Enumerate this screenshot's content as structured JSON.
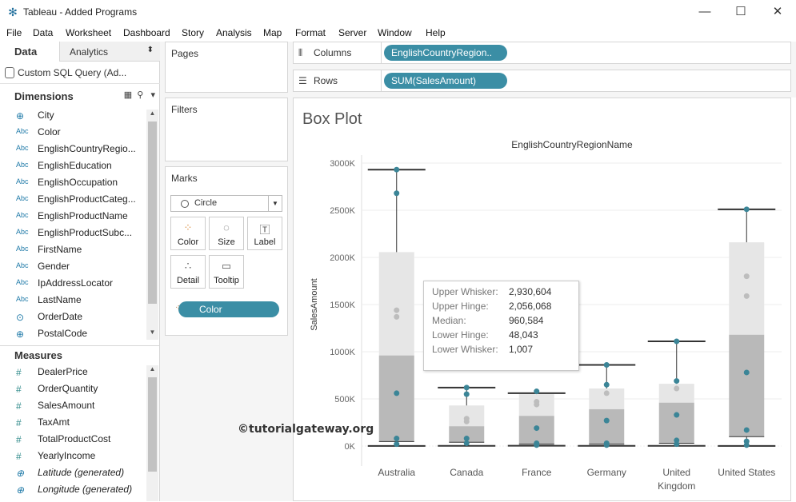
{
  "window": {
    "title": "Tableau - Added Programs",
    "icon": "tableau-icon",
    "minimize": "—",
    "maximize": "☐",
    "close": "✕"
  },
  "menu": [
    "File",
    "Data",
    "Worksheet",
    "Dashboard",
    "Story",
    "Analysis",
    "Map",
    "Format",
    "Server",
    "Window",
    "Help"
  ],
  "left_pane": {
    "tab_data": "Data",
    "tab_analytics": "Analytics",
    "datasource": "Custom SQL Query (Ad...",
    "dimensions_label": "Dimensions",
    "dimensions": [
      {
        "icon": "globe-icon",
        "glyph": "⊕",
        "name": "City"
      },
      {
        "icon": "abc-icon",
        "glyph": "Abc",
        "name": "Color"
      },
      {
        "icon": "abc-icon",
        "glyph": "Abc",
        "name": "EnglishCountryRegio..."
      },
      {
        "icon": "abc-icon",
        "glyph": "Abc",
        "name": "EnglishEducation"
      },
      {
        "icon": "abc-icon",
        "glyph": "Abc",
        "name": "EnglishOccupation"
      },
      {
        "icon": "abc-icon",
        "glyph": "Abc",
        "name": "EnglishProductCateg..."
      },
      {
        "icon": "abc-icon",
        "glyph": "Abc",
        "name": "EnglishProductName"
      },
      {
        "icon": "abc-icon",
        "glyph": "Abc",
        "name": "EnglishProductSubc..."
      },
      {
        "icon": "abc-icon",
        "glyph": "Abc",
        "name": "FirstName"
      },
      {
        "icon": "abc-icon",
        "glyph": "Abc",
        "name": "Gender"
      },
      {
        "icon": "abc-icon",
        "glyph": "Abc",
        "name": "IpAddressLocator"
      },
      {
        "icon": "abc-icon",
        "glyph": "Abc",
        "name": "LastName"
      },
      {
        "icon": "date-icon",
        "glyph": "⊙",
        "name": "OrderDate"
      },
      {
        "icon": "globe-icon",
        "glyph": "⊕",
        "name": "PostalCode"
      }
    ],
    "measures_label": "Measures",
    "measures": [
      {
        "icon": "number-icon",
        "glyph": "#",
        "name": "DealerPrice",
        "italic": false
      },
      {
        "icon": "number-icon",
        "glyph": "#",
        "name": "OrderQuantity",
        "italic": false
      },
      {
        "icon": "number-icon",
        "glyph": "#",
        "name": "SalesAmount",
        "italic": false
      },
      {
        "icon": "number-icon",
        "glyph": "#",
        "name": "TaxAmt",
        "italic": false
      },
      {
        "icon": "number-icon",
        "glyph": "#",
        "name": "TotalProductCost",
        "italic": false
      },
      {
        "icon": "number-icon",
        "glyph": "#",
        "name": "YearlyIncome",
        "italic": false
      },
      {
        "icon": "globe-icon",
        "glyph": "⊕",
        "name": "Latitude (generated)",
        "italic": true
      },
      {
        "icon": "globe-icon",
        "glyph": "⊕",
        "name": "Longitude (generated)",
        "italic": true
      }
    ]
  },
  "cards": {
    "pages": "Pages",
    "filters": "Filters",
    "marks": "Marks",
    "mark_type": "Circle",
    "buttons": {
      "color": "Color",
      "size": "Size",
      "label": "Label",
      "detail": "Detail",
      "tooltip": "Tooltip"
    },
    "color_pill": "Color"
  },
  "shelves": {
    "columns_label": "Columns",
    "columns_pill": "EnglishCountryRegion..",
    "rows_label": "Rows",
    "rows_pill": "SUM(SalesAmount)"
  },
  "viz": {
    "sheet_title": "Box Plot",
    "watermark": "©tutorialgateway.org"
  },
  "tooltip": {
    "rows": [
      {
        "key": "Upper Whisker:",
        "value": "2,930,604"
      },
      {
        "key": "Upper Hinge:",
        "value": "2,056,068"
      },
      {
        "key": "Median:",
        "value": "960,584"
      },
      {
        "key": "Lower Hinge:",
        "value": "48,043"
      },
      {
        "key": "Lower Whisker:",
        "value": "1,007"
      }
    ]
  },
  "chart_data": {
    "type": "scatter",
    "title": "",
    "xlabel": "EnglishCountryRegionName",
    "ylabel": "SalesAmount",
    "ylim": [
      0,
      3000000
    ],
    "yticks": [
      0,
      500000,
      1000000,
      1500000,
      2000000,
      2500000,
      3000000
    ],
    "ytick_labels": [
      "0K",
      "500K",
      "1000K",
      "1500K",
      "2000K",
      "2500K",
      "3000K"
    ],
    "categories": [
      "Australia",
      "Canada",
      "France",
      "Germany",
      "United Kingdom",
      "United States"
    ],
    "category_labels": [
      [
        "Australia"
      ],
      [
        "Canada"
      ],
      [
        "France"
      ],
      [
        "Germany"
      ],
      [
        "United",
        "Kingdom"
      ],
      [
        "United States"
      ]
    ],
    "boxes": [
      {
        "category": "Australia",
        "lower_whisker": 1007,
        "lower_hinge": 48043,
        "median": 960584,
        "upper_hinge": 2056068,
        "upper_whisker": 2930604
      },
      {
        "category": "Canada",
        "lower_whisker": 2000,
        "lower_hinge": 40000,
        "median": 210000,
        "upper_hinge": 430000,
        "upper_whisker": 620000
      },
      {
        "category": "France",
        "lower_whisker": 3000,
        "lower_hinge": 20000,
        "median": 320000,
        "upper_hinge": 550000,
        "upper_whisker": 560000
      },
      {
        "category": "Germany",
        "lower_whisker": 2000,
        "lower_hinge": 20000,
        "median": 390000,
        "upper_hinge": 610000,
        "upper_whisker": 860000
      },
      {
        "category": "United Kingdom",
        "lower_whisker": 2000,
        "lower_hinge": 30000,
        "median": 460000,
        "upper_hinge": 660000,
        "upper_whisker": 1110000
      },
      {
        "category": "United States",
        "lower_whisker": 1000,
        "lower_hinge": 100000,
        "median": 1180000,
        "upper_hinge": 2160000,
        "upper_whisker": 2510000
      }
    ],
    "points": [
      {
        "category": "Australia",
        "values": [
          2930604,
          2680000,
          1440000,
          1370000,
          560000,
          80000,
          20000
        ],
        "highlight": [
          true,
          true,
          false,
          false,
          true,
          true,
          true
        ]
      },
      {
        "category": "Canada",
        "values": [
          620000,
          550000,
          290000,
          260000,
          80000,
          30000
        ],
        "highlight": [
          true,
          true,
          false,
          false,
          true,
          true
        ]
      },
      {
        "category": "France",
        "values": [
          580000,
          470000,
          440000,
          190000,
          30000,
          10000
        ],
        "highlight": [
          true,
          false,
          false,
          true,
          true,
          true
        ]
      },
      {
        "category": "Germany",
        "values": [
          860000,
          650000,
          560000,
          270000,
          30000,
          10000
        ],
        "highlight": [
          true,
          true,
          false,
          true,
          true,
          true
        ]
      },
      {
        "category": "United Kingdom",
        "values": [
          1110000,
          690000,
          610000,
          330000,
          60000,
          20000
        ],
        "highlight": [
          true,
          true,
          false,
          true,
          true,
          true
        ]
      },
      {
        "category": "United States",
        "values": [
          2510000,
          1800000,
          1590000,
          780000,
          170000,
          50000,
          10000
        ],
        "highlight": [
          true,
          false,
          false,
          true,
          true,
          true,
          true
        ]
      }
    ],
    "colors": {
      "point": "#3b8597",
      "point_light": "#bdbdbd",
      "box_upper": "#e6e6e6",
      "box_lower": "#b9b9b9",
      "whisker": "#333333",
      "grid": "#ececec"
    },
    "grid": true
  }
}
